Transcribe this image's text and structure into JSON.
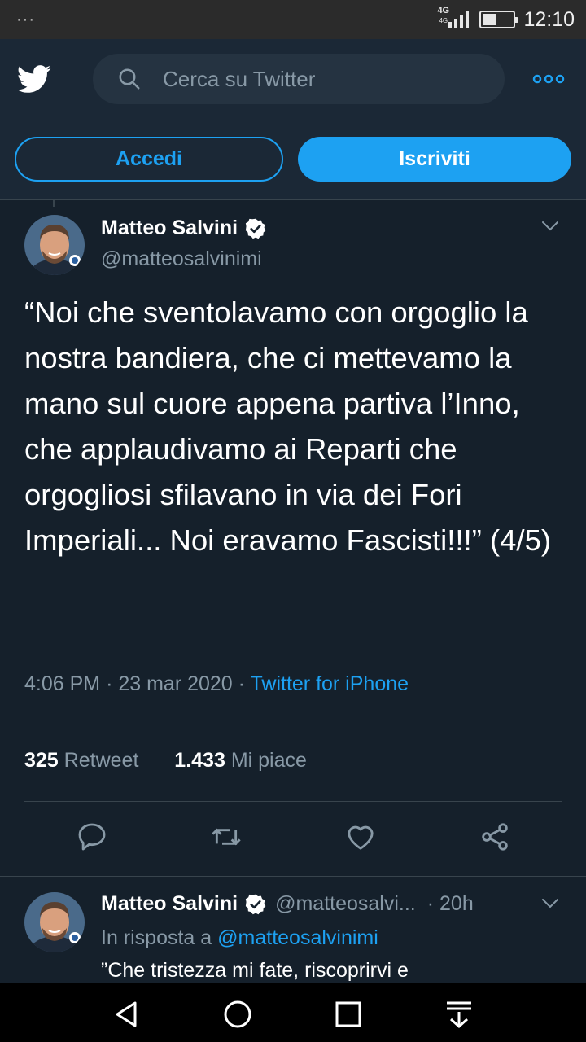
{
  "status_bar": {
    "menu": "···",
    "network": "4G",
    "network_sub": "4G",
    "time": "12:10",
    "battery_level": 0.45
  },
  "header": {
    "search_placeholder": "Cerca su Twitter",
    "login_label": "Accedi",
    "signup_label": "Iscriviti"
  },
  "tweet": {
    "author": "Matteo Salvini",
    "handle": "@matteosalvinimi",
    "text": "“Noi che sventolavamo con orgoglio la nostra bandiera, che ci mettevamo la mano sul cuore appena partiva l’Inno, che applaudivamo ai Reparti che orgogliosi sfilavano in via dei Fori Imperiali... Noi eravamo Fascisti!!!” (4/5)",
    "time": "4:06 PM",
    "date": "23 mar 2020",
    "separator": "·",
    "source": "Twitter for iPhone",
    "retweets_count": "325",
    "retweets_label": "Retweet",
    "likes_count": "1.433",
    "likes_label": "Mi piace"
  },
  "reply": {
    "author": "Matteo Salvini",
    "handle": "@matteosalvi...",
    "time": "· 20h",
    "in_reply_prefix": "In risposta a",
    "in_reply_mention": "@matteosalvinimi",
    "text": "”Che tristezza mi fate, riscoprirvi e"
  },
  "colors": {
    "background": "#15202b",
    "header": "#1b2836",
    "accent": "#1da1f2",
    "muted": "#8899a6",
    "border": "#38444d"
  },
  "icons": [
    "twitter-bird-icon",
    "search-icon",
    "more-icon",
    "verified-icon",
    "chevron-down-icon",
    "reply-icon",
    "retweet-icon",
    "like-icon",
    "share-icon",
    "back-icon",
    "home-icon",
    "recents-icon",
    "notifications-icon"
  ]
}
